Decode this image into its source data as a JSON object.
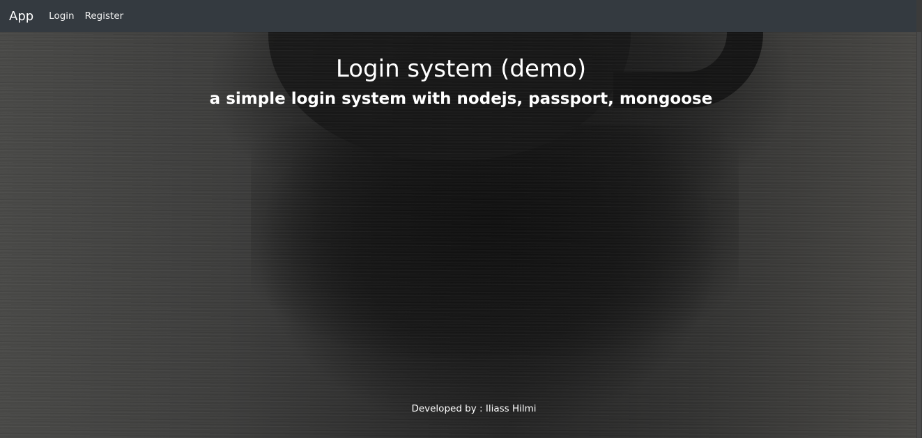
{
  "navbar": {
    "brand": "App",
    "links": [
      {
        "label": "Login"
      },
      {
        "label": "Register"
      }
    ],
    "background_color": "#343a40"
  },
  "hero": {
    "title": "Login system (demo)",
    "subtitle": "a simple login system with nodejs, passport, mongoose"
  },
  "footer": {
    "text": "Developed by : Iliass Hilmi"
  }
}
